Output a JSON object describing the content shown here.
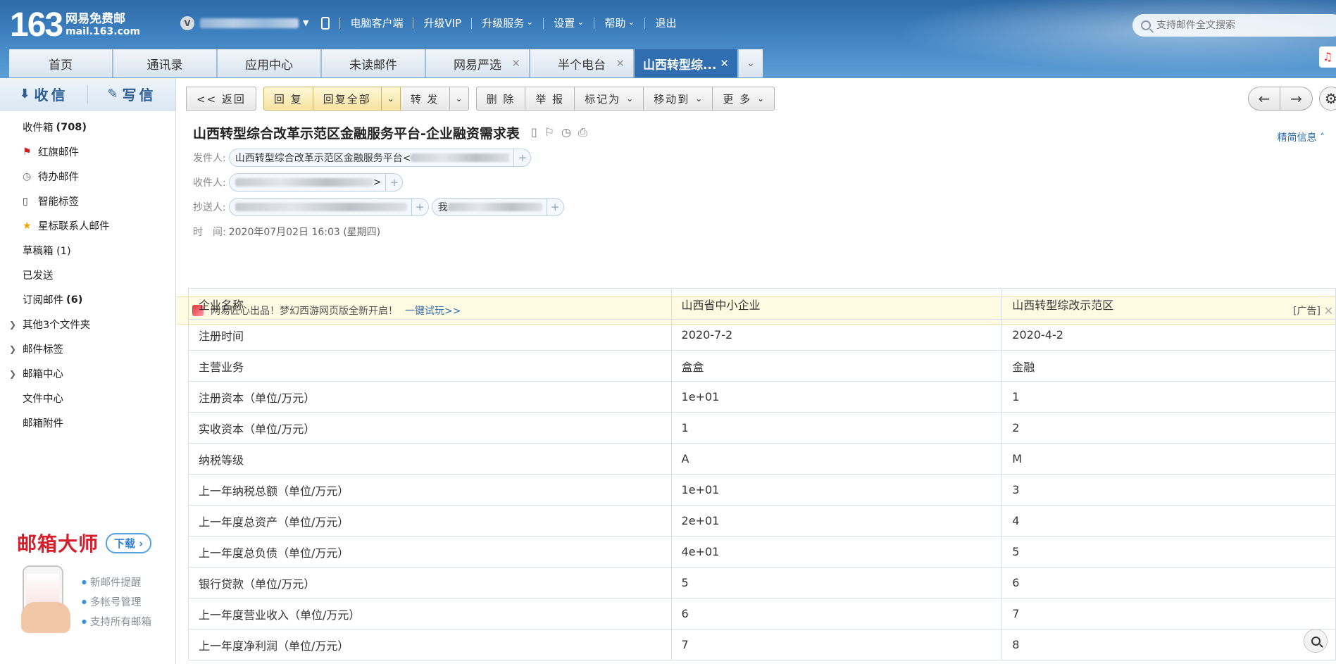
{
  "header": {
    "logo_number": "163",
    "logo_cn": "网易免费邮",
    "logo_en": "mail.163.com",
    "user_avatar_letter": "V",
    "nav": [
      "电脑客户端",
      "升级VIP",
      "升级服务",
      "设置",
      "帮助",
      "退出"
    ],
    "search_placeholder": "支持邮件全文搜索"
  },
  "tabs": [
    {
      "label": "首页",
      "closable": false
    },
    {
      "label": "通讯录",
      "closable": false
    },
    {
      "label": "应用中心",
      "closable": false
    },
    {
      "label": "未读邮件",
      "closable": false
    },
    {
      "label": "网易严选",
      "closable": true
    },
    {
      "label": "半个电台",
      "closable": true
    },
    {
      "label": "山西转型综...",
      "closable": true,
      "active": true
    }
  ],
  "sidebar": {
    "receive": "收信",
    "compose": "写信",
    "folders": [
      {
        "label": "收件箱",
        "count": "(708)",
        "icon": "inbox"
      },
      {
        "label": "红旗邮件",
        "icon": "flag-icon"
      },
      {
        "label": "待办邮件",
        "icon": "clock-icon"
      },
      {
        "label": "智能标签",
        "icon": "bookmark-icon"
      },
      {
        "label": "星标联系人邮件",
        "icon": "star-icon"
      },
      {
        "label": "草稿箱 (1)"
      },
      {
        "label": "已发送"
      },
      {
        "label": "订阅邮件",
        "count": "(6)"
      },
      {
        "label": "其他3个文件夹",
        "expandable": true
      },
      {
        "label": "邮件标签",
        "expandable": true
      },
      {
        "label": "邮箱中心",
        "expandable": true
      },
      {
        "label": "文件中心"
      },
      {
        "label": "邮箱附件"
      }
    ],
    "promo": {
      "title": "邮箱大师",
      "download": "下载",
      "features": [
        "新邮件提醒",
        "多帐号管理",
        "支持所有邮箱"
      ]
    }
  },
  "toolbar": {
    "back": "<< 返回",
    "reply": "回 复",
    "reply_all": "回复全部",
    "forward": "转 发",
    "delete": "删 除",
    "report": "举 报",
    "mark_as": "标记为",
    "move_to": "移动到",
    "more": "更 多"
  },
  "mail": {
    "subject": "山西转型综合改革示范区金融服务平台-企业融资需求表",
    "brief_info": "精简信息",
    "from_label": "发件人:",
    "from_name": "山西转型综合改革示范区金融服务平台<",
    "to_label": "收件人:",
    "to_suffix": ">",
    "cc_label": "抄送人:",
    "cc_second_prefix": "我",
    "time_label": "时　间:",
    "time_value": "2020年07月02日 16:03 (星期四)"
  },
  "ad": {
    "text": "网易匠心出品！梦幻西游网页版全新开启！",
    "link": "一键试玩>>",
    "tag": "[广告]"
  },
  "table": [
    [
      "企业名称",
      "山西省中小企业",
      "山西转型综改示范区"
    ],
    [
      "注册时间",
      "2020-7-2",
      "2020-4-2"
    ],
    [
      "主营业务",
      "盒盒",
      "金融"
    ],
    [
      "注册资本（单位/万元）",
      "1e+01",
      "1"
    ],
    [
      "实收资本（单位/万元）",
      "1",
      "2"
    ],
    [
      "纳税等级",
      "A",
      "M"
    ],
    [
      "上一年纳税总额（单位/万元）",
      "1e+01",
      "3"
    ],
    [
      "上一年度总资产（单位/万元）",
      "2e+01",
      "4"
    ],
    [
      "上一年度总负债（单位/万元）",
      "4e+01",
      "5"
    ],
    [
      "银行贷款（单位/万元）",
      "5",
      "6"
    ],
    [
      "上一年度营业收入（单位/万元）",
      "6",
      "7"
    ],
    [
      "上一年度净利润（单位/万元）",
      "7",
      "8"
    ]
  ],
  "colors": {
    "header_blue": "#3f82c2",
    "active_tab": "#2f6eb0",
    "flag_red": "#d81e1e",
    "star_yellow": "#f0a30a",
    "promo_red": "#d61f2c"
  }
}
